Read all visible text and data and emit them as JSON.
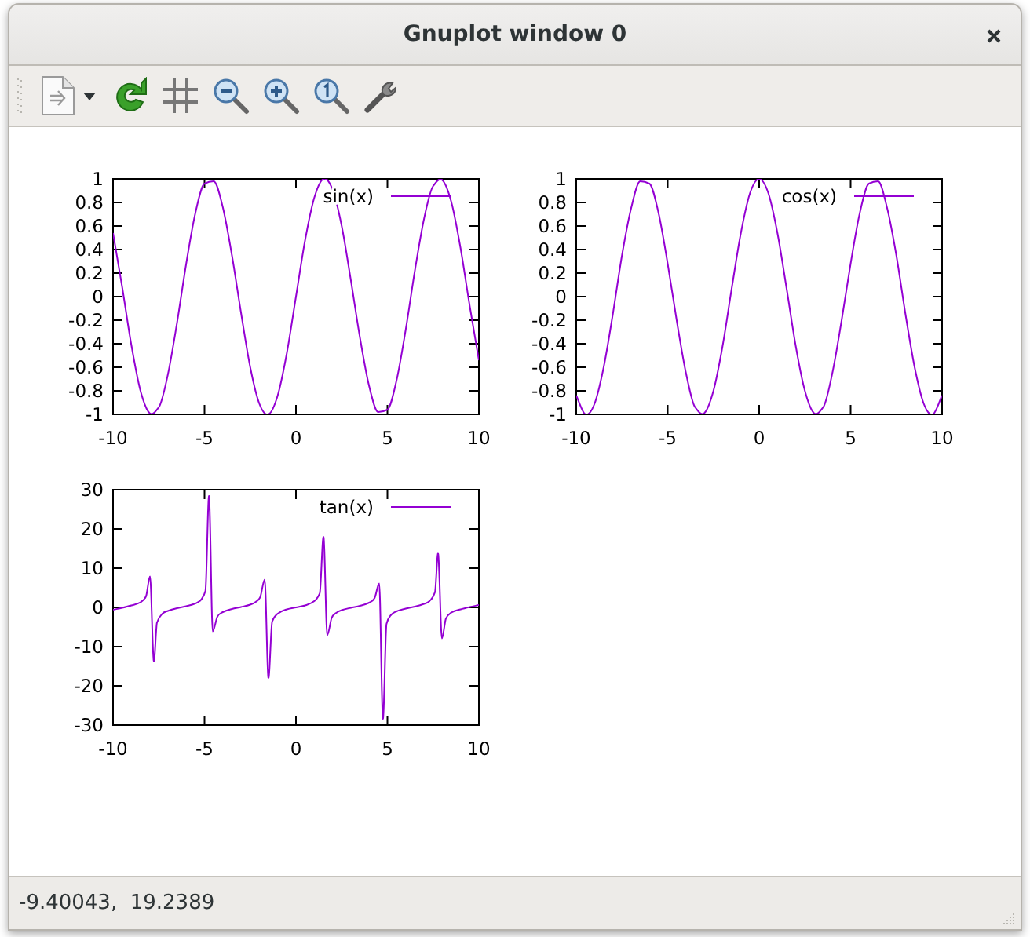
{
  "window": {
    "title": "Gnuplot window 0"
  },
  "plots": [
    {
      "chart_data": {
        "type": "line",
        "x": [
          -10,
          -9.5,
          -9,
          -8.5,
          -8,
          -7.5,
          -7,
          -6.5,
          -6,
          -5.5,
          -5,
          -4.5,
          -4,
          -3.5,
          -3,
          -2.5,
          -2,
          -1.5,
          -1,
          -0.5,
          0,
          0.5,
          1,
          1.5,
          2,
          2.5,
          3,
          3.5,
          4,
          4.5,
          5,
          5.5,
          6,
          6.5,
          7,
          7.5,
          8,
          8.5,
          9,
          9.5,
          10
        ],
        "xlim": [
          -10,
          10
        ],
        "ylim": [
          -1,
          1
        ],
        "xticks": [
          -10,
          -5,
          0,
          5,
          10
        ],
        "yticks": [
          -1,
          -0.8,
          -0.6,
          -0.4,
          -0.2,
          0,
          0.2,
          0.4,
          0.6,
          0.8,
          1
        ],
        "series": [
          {
            "name": "sin(x)",
            "color": "#9400d3",
            "values": [
              0.54,
              0.08,
              -0.41,
              -0.8,
              -0.99,
              -0.94,
              -0.66,
              -0.22,
              0.28,
              0.71,
              0.96,
              0.98,
              0.76,
              0.35,
              -0.14,
              -0.6,
              -0.91,
              -1,
              -0.84,
              -0.48,
              0,
              0.48,
              0.84,
              1,
              0.91,
              0.6,
              0.14,
              -0.35,
              -0.76,
              -0.98,
              -0.96,
              -0.71,
              -0.28,
              0.22,
              0.66,
              0.94,
              0.99,
              0.8,
              0.41,
              -0.08,
              -0.54
            ]
          }
        ]
      }
    },
    {
      "chart_data": {
        "type": "line",
        "x": [
          -10,
          -9.5,
          -9,
          -8.5,
          -8,
          -7.5,
          -7,
          -6.5,
          -6,
          -5.5,
          -5,
          -4.5,
          -4,
          -3.5,
          -3,
          -2.5,
          -2,
          -1.5,
          -1,
          -0.5,
          0,
          0.5,
          1,
          1.5,
          2,
          2.5,
          3,
          3.5,
          4,
          4.5,
          5,
          5.5,
          6,
          6.5,
          7,
          7.5,
          8,
          8.5,
          9,
          9.5,
          10
        ],
        "xlim": [
          -10,
          10
        ],
        "ylim": [
          -1,
          1
        ],
        "xticks": [
          -10,
          -5,
          0,
          5,
          10
        ],
        "yticks": [
          -1,
          -0.8,
          -0.6,
          -0.4,
          -0.2,
          0,
          0.2,
          0.4,
          0.6,
          0.8,
          1
        ],
        "series": [
          {
            "name": "cos(x)",
            "color": "#9400d3",
            "values": [
              -0.84,
              -1,
              -0.91,
              -0.6,
              -0.15,
              0.35,
              0.75,
              0.98,
              0.96,
              0.71,
              0.28,
              -0.21,
              -0.65,
              -0.94,
              -0.99,
              -0.8,
              -0.42,
              0.07,
              0.54,
              0.88,
              1,
              0.88,
              0.54,
              0.07,
              -0.42,
              -0.8,
              -0.99,
              -0.94,
              -0.65,
              -0.21,
              0.28,
              0.71,
              0.96,
              0.98,
              0.75,
              0.35,
              -0.15,
              -0.6,
              -0.91,
              -1,
              -0.84
            ]
          }
        ]
      }
    },
    {
      "chart_data": {
        "type": "line",
        "x": [
          -10,
          -9.5,
          -9,
          -8.5,
          -8.2,
          -7.98,
          -7.78,
          -7.6,
          -7.3,
          -7,
          -6.5,
          -6,
          -5.5,
          -5.2,
          -4.95,
          -4.748,
          -4.55,
          -4.3,
          -4,
          -3.5,
          -3,
          -2.5,
          -2.2,
          -1.95,
          -1.71,
          -1.515,
          -1.3,
          -1,
          -0.5,
          0,
          0.5,
          1,
          1.3,
          1.515,
          1.71,
          1.95,
          2.2,
          2.5,
          3,
          3.5,
          4,
          4.3,
          4.55,
          4.748,
          4.95,
          5.2,
          5.5,
          6,
          6.5,
          7,
          7.3,
          7.6,
          7.78,
          7.98,
          8.2,
          8.5,
          9,
          9.5,
          10
        ],
        "xlim": [
          -10,
          10
        ],
        "ylim": [
          -30,
          30
        ],
        "xticks": [
          -10,
          -5,
          0,
          5,
          10
        ],
        "yticks": [
          -30,
          -20,
          -10,
          0,
          10,
          20,
          30
        ],
        "series": [
          {
            "name": "tan(x)",
            "color": "#9400d3",
            "values": [
              -0.6,
              -0.1,
              0.5,
              1.3,
              2.8,
              7.9,
              -13.5,
              -3.9,
              -1.6,
              -0.9,
              -0.2,
              0.3,
              1,
              1.9,
              4.2,
              28.3,
              -6.1,
              -2.4,
              -1.2,
              -0.4,
              0.1,
              0.7,
              1.4,
              2.7,
              7.1,
              -17.8,
              -3.6,
              -1.6,
              -0.5,
              0,
              0.5,
              1.6,
              3.6,
              17.8,
              -7.1,
              -2.7,
              -1.4,
              -0.7,
              -0.1,
              0.4,
              1.2,
              2.4,
              6.1,
              -28.3,
              -4.2,
              -1.9,
              -1,
              -0.3,
              0.2,
              0.9,
              1.6,
              3.9,
              13.5,
              -7.9,
              -2.8,
              -1.3,
              -0.5,
              0.1,
              0.6
            ]
          }
        ]
      }
    }
  ],
  "status_bar": {
    "text": "-9.40043,  19.2389"
  }
}
